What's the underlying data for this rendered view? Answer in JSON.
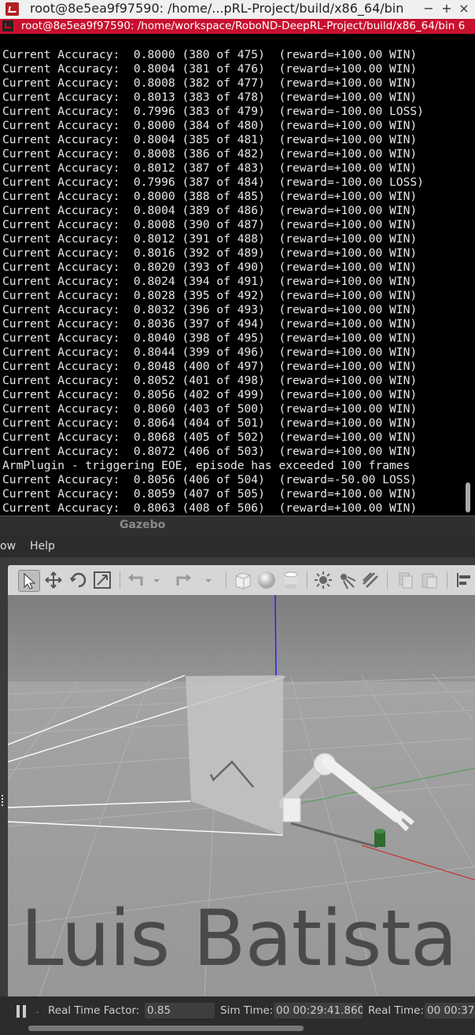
{
  "terminal": {
    "title": "root@8e5ea9f97590: /home/...pRL-Project/build/x86_64/bin",
    "controls": {
      "minimize": "−",
      "maximize": "+",
      "close": "×"
    },
    "tab_title": "root@8e5ea9f97590: /home/workspace/RoboND-DeepRL-Project/build/x86_64/bin 6",
    "lines": [
      "Current Accuracy:  0.8000 (380 of 475)  (reward=+100.00 WIN)",
      "Current Accuracy:  0.8004 (381 of 476)  (reward=+100.00 WIN)",
      "Current Accuracy:  0.8008 (382 of 477)  (reward=+100.00 WIN)",
      "Current Accuracy:  0.8013 (383 of 478)  (reward=+100.00 WIN)",
      "Current Accuracy:  0.7996 (383 of 479)  (reward=-100.00 LOSS)",
      "Current Accuracy:  0.8000 (384 of 480)  (reward=+100.00 WIN)",
      "Current Accuracy:  0.8004 (385 of 481)  (reward=+100.00 WIN)",
      "Current Accuracy:  0.8008 (386 of 482)  (reward=+100.00 WIN)",
      "Current Accuracy:  0.8012 (387 of 483)  (reward=+100.00 WIN)",
      "Current Accuracy:  0.7996 (387 of 484)  (reward=-100.00 LOSS)",
      "Current Accuracy:  0.8000 (388 of 485)  (reward=+100.00 WIN)",
      "Current Accuracy:  0.8004 (389 of 486)  (reward=+100.00 WIN)",
      "Current Accuracy:  0.8008 (390 of 487)  (reward=+100.00 WIN)",
      "Current Accuracy:  0.8012 (391 of 488)  (reward=+100.00 WIN)",
      "Current Accuracy:  0.8016 (392 of 489)  (reward=+100.00 WIN)",
      "Current Accuracy:  0.8020 (393 of 490)  (reward=+100.00 WIN)",
      "Current Accuracy:  0.8024 (394 of 491)  (reward=+100.00 WIN)",
      "Current Accuracy:  0.8028 (395 of 492)  (reward=+100.00 WIN)",
      "Current Accuracy:  0.8032 (396 of 493)  (reward=+100.00 WIN)",
      "Current Accuracy:  0.8036 (397 of 494)  (reward=+100.00 WIN)",
      "Current Accuracy:  0.8040 (398 of 495)  (reward=+100.00 WIN)",
      "Current Accuracy:  0.8044 (399 of 496)  (reward=+100.00 WIN)",
      "Current Accuracy:  0.8048 (400 of 497)  (reward=+100.00 WIN)",
      "Current Accuracy:  0.8052 (401 of 498)  (reward=+100.00 WIN)",
      "Current Accuracy:  0.8056 (402 of 499)  (reward=+100.00 WIN)",
      "Current Accuracy:  0.8060 (403 of 500)  (reward=+100.00 WIN)",
      "Current Accuracy:  0.8064 (404 of 501)  (reward=+100.00 WIN)",
      "Current Accuracy:  0.8068 (405 of 502)  (reward=+100.00 WIN)",
      "Current Accuracy:  0.8072 (406 of 503)  (reward=+100.00 WIN)",
      "ArmPlugin - triggering EOE, episode has exceeded 100 frames",
      "Current Accuracy:  0.8056 (406 of 504)  (reward=-50.00 LOSS)",
      "Current Accuracy:  0.8059 (407 of 505)  (reward=+100.00 WIN)",
      "Current Accuracy:  0.8063 (408 of 506)  (reward=+100.00 WIN)"
    ]
  },
  "gazebo": {
    "title": "Gazebo",
    "menu": {
      "window_partial": "ow",
      "help": "Help"
    },
    "toolbar_icons": [
      "select-arrow-icon",
      "translate-icon",
      "rotate-icon",
      "scale-icon",
      "undo-icon",
      "undo-dropdown-icon",
      "redo-icon",
      "redo-dropdown-icon",
      "box-shape-icon",
      "sphere-shape-icon",
      "cylinder-shape-icon",
      "point-light-icon",
      "spot-light-icon",
      "directional-light-icon",
      "copy-icon",
      "paste-icon",
      "align-icon"
    ],
    "watermark": "Luis Batista",
    "status": {
      "real_time_factor_label": "Real Time Factor:",
      "real_time_factor_value": "0.85",
      "sim_time_label": "Sim Time:",
      "sim_time_value": "00 00:29:41.860",
      "real_time_label": "Real Time:",
      "real_time_value": "00 00:37:"
    }
  },
  "colors": {
    "terminal_tab_accent": "#c8102e",
    "terminal_background": "#000000",
    "gazebo_viewport": "#9c9c9c"
  }
}
